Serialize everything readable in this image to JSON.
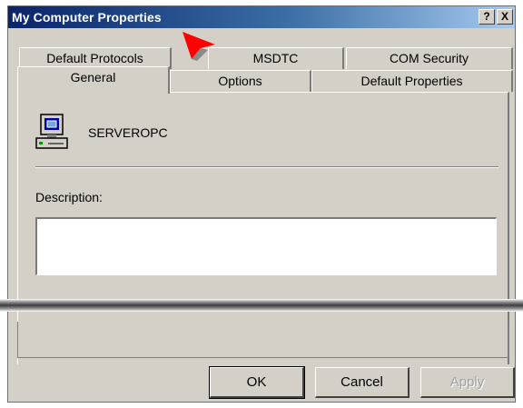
{
  "window": {
    "title": "My Computer Properties"
  },
  "title_buttons": {
    "help": "?",
    "close": "X"
  },
  "tabs_back": [
    "Default Protocols",
    "MSDTC",
    "COM Security"
  ],
  "tabs_front": [
    "General",
    "Options",
    "Default Properties"
  ],
  "active_tab": "General",
  "general": {
    "computer_name": "SERVEROPC",
    "description_label": "Description:",
    "description_value": ""
  },
  "buttons": {
    "ok": "OK",
    "cancel": "Cancel",
    "apply": "Apply"
  },
  "icons": {
    "computer": "computer-icon",
    "cursor": "pointer-cursor-icon"
  },
  "colors": {
    "title_start": "#0a246a",
    "title_end": "#a6caf0",
    "face": "#d4d0c8",
    "cursor": "#ff0000"
  }
}
